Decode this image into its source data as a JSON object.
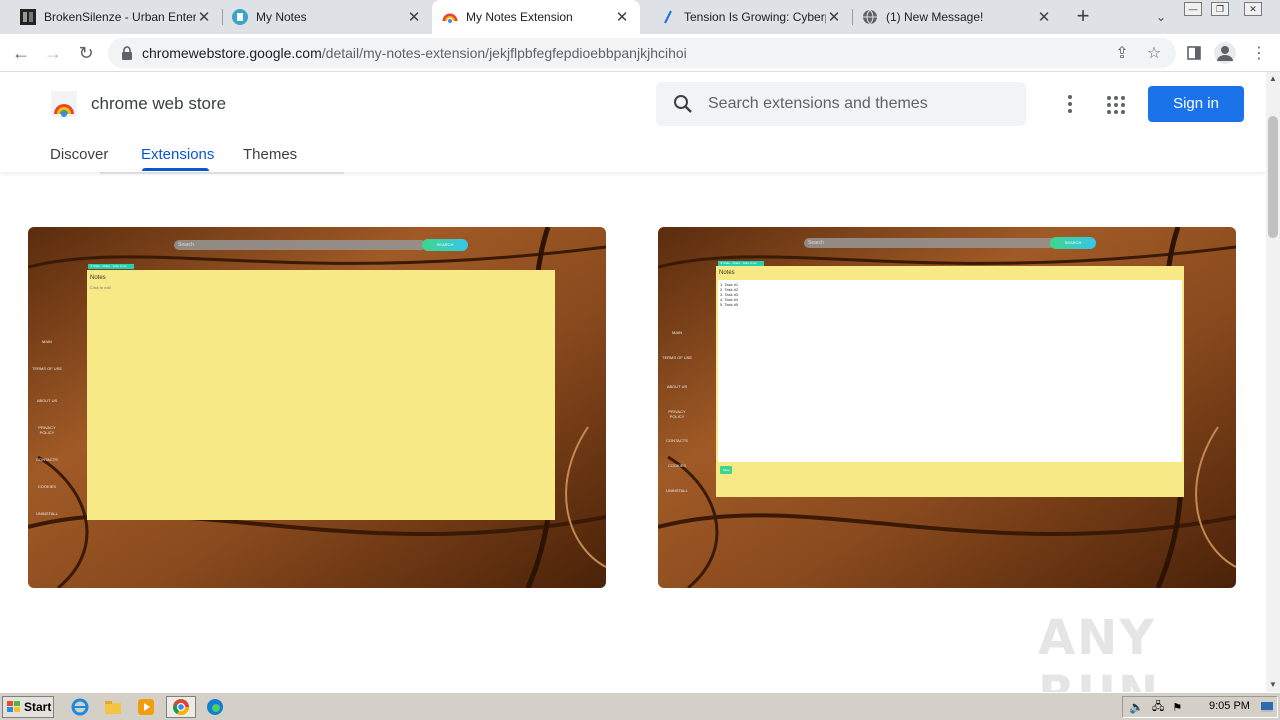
{
  "browser": {
    "tabs": [
      {
        "title": "BrokenSilenze - Urban Entertainment",
        "active": false
      },
      {
        "title": "My Notes",
        "active": false
      },
      {
        "title": "My Notes Extension",
        "active": true
      },
      {
        "title": "Tension Is Growing: Cyberpunk",
        "active": false
      },
      {
        "title": "(1) New Message!",
        "active": false
      }
    ],
    "url_host": "chromewebstore.google.com",
    "url_path": "/detail/my-notes-extension/jekjflpbfegfepdioebbpanjkjhcihoi"
  },
  "store": {
    "title": "chrome web store",
    "search_placeholder": "Search extensions and themes",
    "sign_in": "Sign in",
    "nav": [
      "Discover",
      "Extensions",
      "Themes"
    ],
    "active_nav": "Extensions"
  },
  "screenshots": [
    {
      "search_placeholder": "Search",
      "search_button": "SEARCH",
      "chip": "★ Rate · share · write to us",
      "note_title": "Notes",
      "note_sub": "Click to edit",
      "side_links": [
        "MAIN",
        "TERMS OF USE",
        "ABOUT US",
        "PRIVACY POLICY",
        "CONTACTS",
        "COOKIES",
        "UNINSTALL"
      ]
    },
    {
      "search_placeholder": "Search",
      "search_button": "SEARCH",
      "chip": "★ Rate · share · write to us",
      "note_title": "Notes",
      "tasks": [
        "1. Task #1",
        "2. Task #2",
        "3. Task #3",
        "4. Task #4",
        "5. Task #5"
      ],
      "green_label": "Save",
      "side_links": [
        "MAIN",
        "TERMS OF USE",
        "ABOUT US",
        "PRIVACY POLICY",
        "CONTACTS",
        "COOKIES",
        "UNINSTALL"
      ]
    }
  ],
  "watermark": "ANY RUN",
  "taskbar": {
    "start": "Start",
    "clock": "9:05 PM"
  },
  "colors": {
    "accent": "#1a73e8",
    "active_nav": "#0b57d0",
    "note_yellow": "#f7e985",
    "wood": "#8a4a1e"
  }
}
